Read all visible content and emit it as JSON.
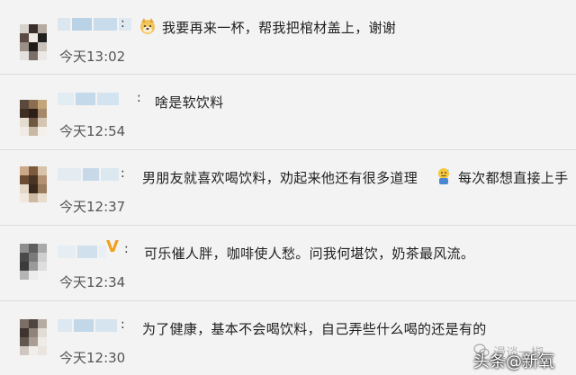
{
  "comments": [
    {
      "message": "我要再来一杯，帮我把棺材盖上，谢谢",
      "time": "今天13:02",
      "emoji": "doge-emoji"
    },
    {
      "message": "啥是软饮料",
      "time": "今天12:54"
    },
    {
      "message": "男朋友就喜欢喝饮料，劝起来他还有很多道理",
      "message_tail": "每次都想直接上手",
      "time": "今天12:37",
      "emoji": "sweat-emoji"
    },
    {
      "message": "可乐催人胖，咖啡使人愁。问我何堪饮，奶茶最风流。",
      "time": "今天12:34",
      "badge": "V"
    },
    {
      "message": "为了健康，基本不会喝饮料，自己弄些什么喝的还是有的",
      "time": "今天12:30"
    }
  ],
  "watermarks": {
    "channel": "漫谈一椒",
    "source": "头条@新氧"
  },
  "colors": {
    "background": "#f3f3f3",
    "badge": "#f0a21b"
  }
}
